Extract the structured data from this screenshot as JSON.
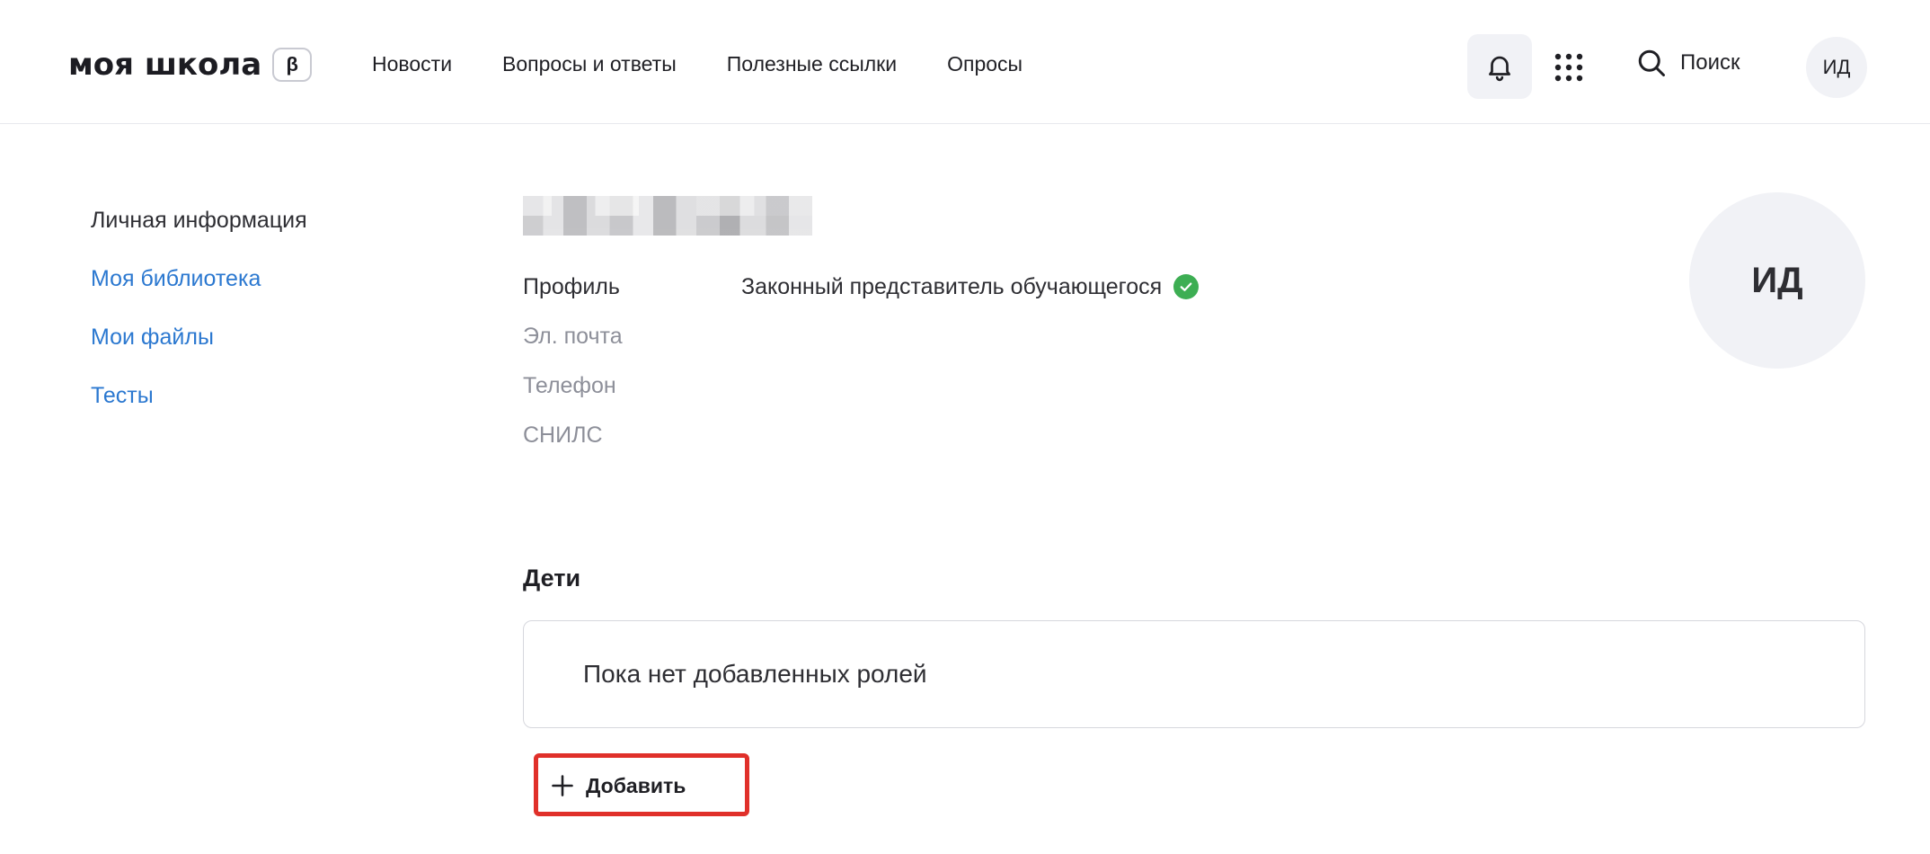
{
  "header": {
    "logo_text": "моя школа",
    "beta_badge": "β",
    "nav": [
      "Новости",
      "Вопросы и ответы",
      "Полезные ссылки",
      "Опросы"
    ],
    "search_label": "Поиск",
    "avatar_initials": "ИД"
  },
  "sidebar": {
    "items": [
      {
        "label": "Личная информация",
        "active": true
      },
      {
        "label": "Моя библиотека",
        "active": false
      },
      {
        "label": "Мои файлы",
        "active": false
      },
      {
        "label": "Тесты",
        "active": false
      }
    ]
  },
  "profile": {
    "fields": {
      "profile_label": "Профиль",
      "profile_value": "Законный представитель обучающегося",
      "email_label": "Эл. почта",
      "phone_label": "Телефон",
      "snils_label": "СНИЛС"
    },
    "avatar_initials": "ИД"
  },
  "children": {
    "title": "Дети",
    "empty_text": "Пока нет добавленных ролей",
    "add_label": "Добавить"
  },
  "colors": {
    "link": "#2b78d0",
    "verified": "#3dae53",
    "highlight": "#e0302a"
  }
}
